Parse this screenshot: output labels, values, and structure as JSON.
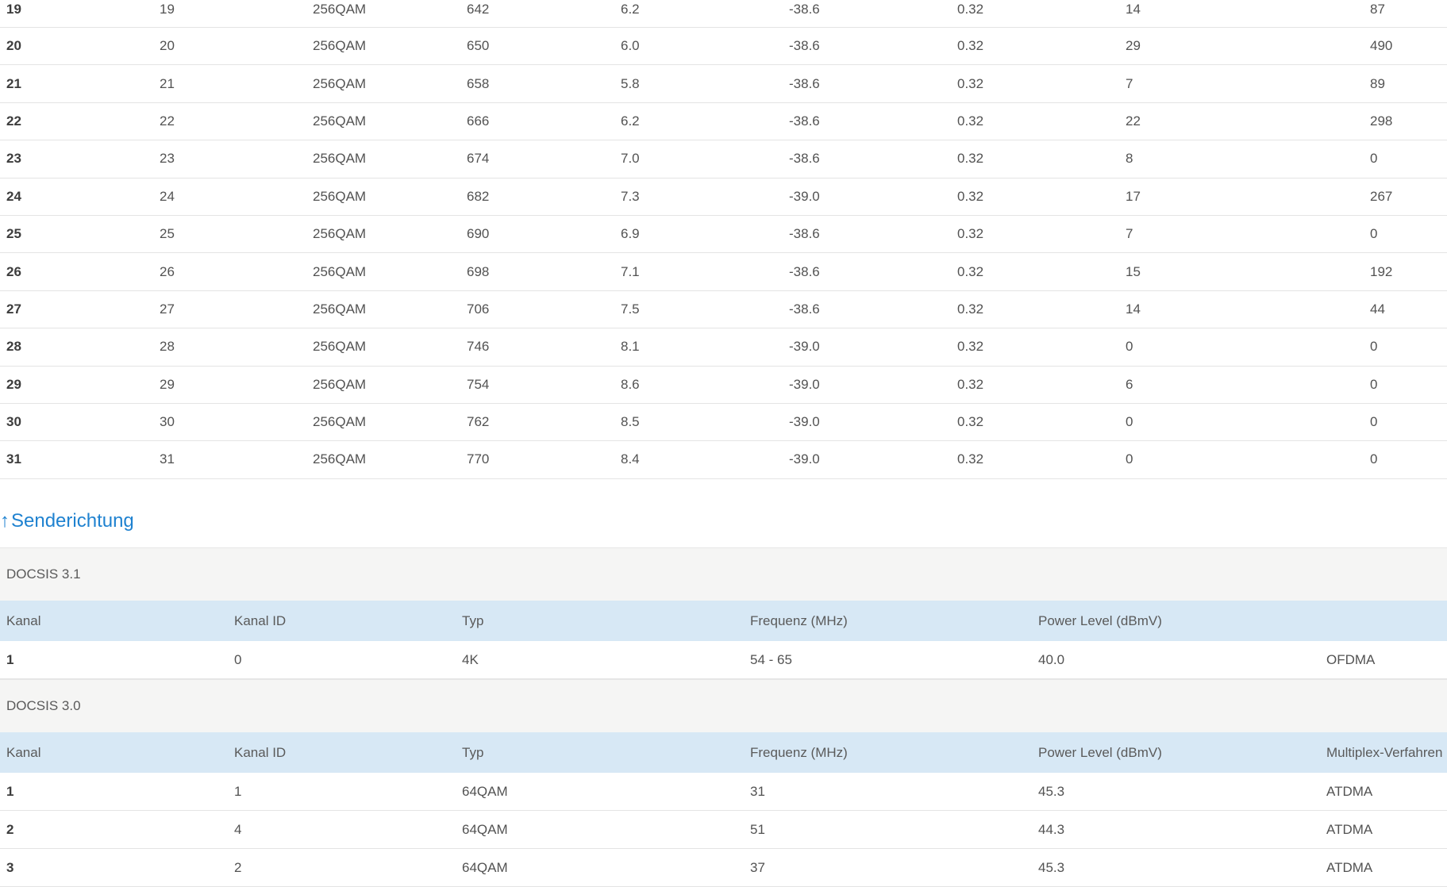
{
  "downstream_rows": [
    [
      "19",
      "19",
      "256QAM",
      "642",
      "6.2",
      "-38.6",
      "0.32",
      "14",
      "87"
    ],
    [
      "20",
      "20",
      "256QAM",
      "650",
      "6.0",
      "-38.6",
      "0.32",
      "29",
      "490"
    ],
    [
      "21",
      "21",
      "256QAM",
      "658",
      "5.8",
      "-38.6",
      "0.32",
      "7",
      "89"
    ],
    [
      "22",
      "22",
      "256QAM",
      "666",
      "6.2",
      "-38.6",
      "0.32",
      "22",
      "298"
    ],
    [
      "23",
      "23",
      "256QAM",
      "674",
      "7.0",
      "-38.6",
      "0.32",
      "8",
      "0"
    ],
    [
      "24",
      "24",
      "256QAM",
      "682",
      "7.3",
      "-39.0",
      "0.32",
      "17",
      "267"
    ],
    [
      "25",
      "25",
      "256QAM",
      "690",
      "6.9",
      "-38.6",
      "0.32",
      "7",
      "0"
    ],
    [
      "26",
      "26",
      "256QAM",
      "698",
      "7.1",
      "-38.6",
      "0.32",
      "15",
      "192"
    ],
    [
      "27",
      "27",
      "256QAM",
      "706",
      "7.5",
      "-38.6",
      "0.32",
      "14",
      "44"
    ],
    [
      "28",
      "28",
      "256QAM",
      "746",
      "8.1",
      "-39.0",
      "0.32",
      "0",
      "0"
    ],
    [
      "29",
      "29",
      "256QAM",
      "754",
      "8.6",
      "-39.0",
      "0.32",
      "6",
      "0"
    ],
    [
      "30",
      "30",
      "256QAM",
      "762",
      "8.5",
      "-39.0",
      "0.32",
      "0",
      "0"
    ],
    [
      "31",
      "31",
      "256QAM",
      "770",
      "8.4",
      "-39.0",
      "0.32",
      "0",
      "0"
    ]
  ],
  "upstream": {
    "heading_arrow": "↑",
    "heading": "Senderichtung",
    "docsis31": {
      "title": "DOCSIS 3.1",
      "headers": [
        "Kanal",
        "Kanal ID",
        "Typ",
        "Frequenz (MHz)",
        "Power Level (dBmV)",
        ""
      ],
      "rows": [
        [
          "1",
          "0",
          "4K",
          "54 - 65",
          "40.0",
          "OFDMA"
        ]
      ]
    },
    "docsis30": {
      "title": "DOCSIS 3.0",
      "headers": [
        "Kanal",
        "Kanal ID",
        "Typ",
        "Frequenz (MHz)",
        "Power Level (dBmV)",
        "Multiplex-Verfahren"
      ],
      "rows": [
        [
          "1",
          "1",
          "64QAM",
          "31",
          "45.3",
          "ATDMA"
        ],
        [
          "2",
          "4",
          "64QAM",
          "51",
          "44.3",
          "ATDMA"
        ],
        [
          "3",
          "2",
          "64QAM",
          "37",
          "45.3",
          "ATDMA"
        ]
      ]
    }
  }
}
